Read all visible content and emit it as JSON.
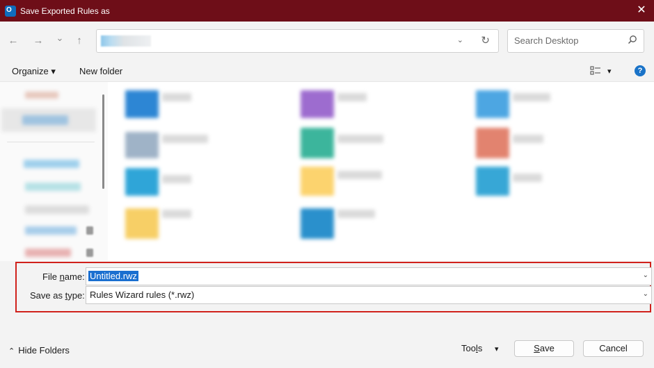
{
  "window": {
    "title": "Save Exported Rules as",
    "close_glyph": "✕",
    "icon": "outlook-app-icon"
  },
  "nav": {
    "back_glyph": "←",
    "forward_glyph": "→",
    "recent_glyph": "⌄",
    "up_glyph": "↑",
    "address_dropdown_glyph": "⌄",
    "refresh_glyph": "↻",
    "search_placeholder": "Search Desktop"
  },
  "toolbar": {
    "organize_label": "Organize ▾",
    "new_folder_label": "New folder",
    "view_dropdown_glyph": "▾",
    "help_glyph": "?"
  },
  "form": {
    "file_name_label_pre": "File ",
    "file_name_label_u": "n",
    "file_name_label_post": "ame:",
    "file_name_value": "Untitled.rwz",
    "save_type_label_pre": "Save as ",
    "save_type_label_u": "t",
    "save_type_label_post": "ype:",
    "save_type_value": "Rules Wizard rules (*.rwz)",
    "dropdown_glyph": "⌄"
  },
  "footer": {
    "hide_folders_label": "Hide Folders",
    "hide_glyph": "⌃",
    "tools_label_pre": "Too",
    "tools_label_u": "l",
    "tools_label_post": "s",
    "tools_glyph": "▾",
    "save_label_u": "S",
    "save_label_post": "ave",
    "cancel_label": "Cancel"
  },
  "colors": {
    "titlebar": "#6e0e18",
    "highlight_border": "#d0211b",
    "selection": "#1a6fd0",
    "help": "#1a73c8"
  }
}
